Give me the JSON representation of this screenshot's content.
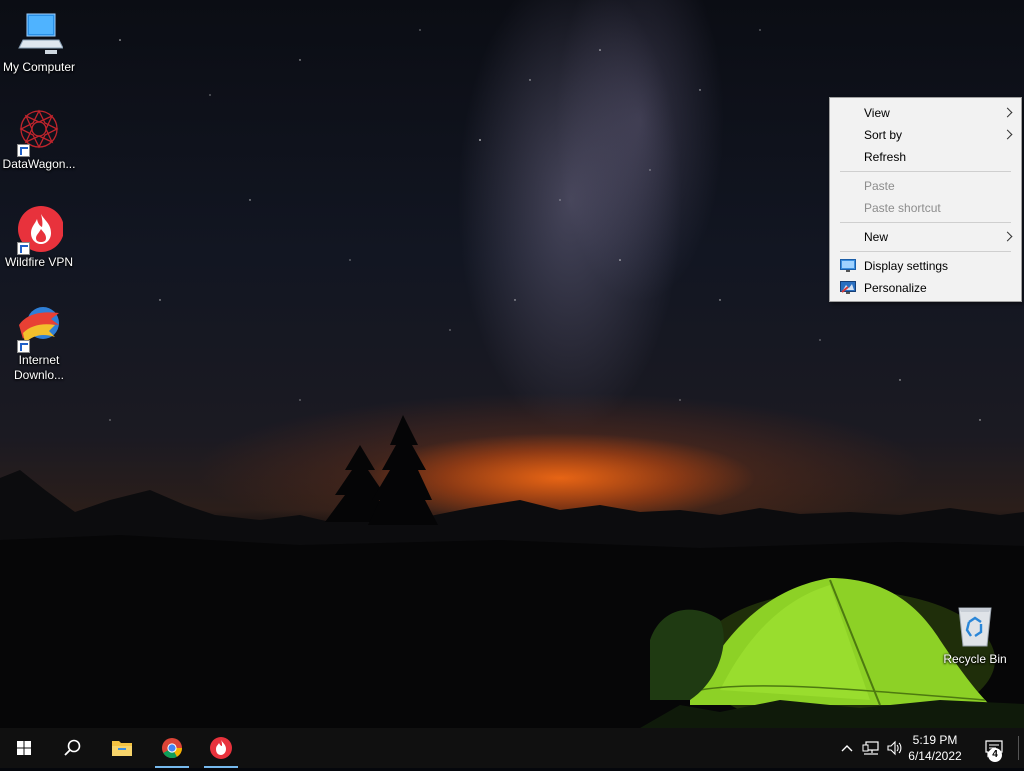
{
  "desktop": {
    "icons": [
      {
        "label": "My Computer"
      },
      {
        "label": "DataWagon..."
      },
      {
        "label": "Wildfire VPN"
      },
      {
        "label_line1": "Internet",
        "label_line2": "Downlo..."
      },
      {
        "label": "Recycle Bin"
      }
    ]
  },
  "context_menu": {
    "items": [
      {
        "label": "View",
        "has_submenu": true
      },
      {
        "label": "Sort by",
        "has_submenu": true
      },
      {
        "label": "Refresh"
      },
      {
        "label": "Paste",
        "disabled": true
      },
      {
        "label": "Paste shortcut",
        "disabled": true
      },
      {
        "label": "New",
        "has_submenu": true
      },
      {
        "label": "Display settings",
        "icon": "display-icon"
      },
      {
        "label": "Personalize",
        "icon": "personalize-icon"
      }
    ]
  },
  "taskbar": {
    "pinned": [
      {
        "name": "start-button",
        "icon": "windows-logo-icon"
      },
      {
        "name": "search-button",
        "icon": "search-icon"
      },
      {
        "name": "file-explorer",
        "icon": "folder-icon"
      },
      {
        "name": "chrome",
        "icon": "chrome-icon"
      },
      {
        "name": "wildfire-vpn",
        "icon": "wildfire-icon"
      }
    ],
    "tray": {
      "time": "5:19 PM",
      "date": "6/14/2022",
      "notification_count": "4"
    }
  },
  "colors": {
    "taskbar_bg": "#101010",
    "menu_bg": "#f2f2f2",
    "active_indicator": "#76b9ed",
    "wildfire_red": "#e8323c"
  }
}
